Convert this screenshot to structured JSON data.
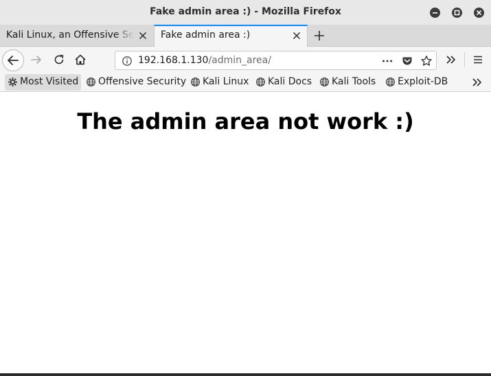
{
  "window": {
    "title": "Fake admin area :) - Mozilla Firefox"
  },
  "tabs": [
    {
      "label": "Kali Linux, an Offensive Security",
      "active": false
    },
    {
      "label": "Fake admin area :)",
      "active": true
    }
  ],
  "urlbar": {
    "host": "192.168.1.130",
    "path": "/admin_area/"
  },
  "bookmarks": [
    {
      "label": "Most Visited",
      "icon": "gear-icon"
    },
    {
      "label": "Offensive Security",
      "icon": "globe-icon"
    },
    {
      "label": "Kali Linux",
      "icon": "globe-icon"
    },
    {
      "label": "Kali Docs",
      "icon": "globe-icon"
    },
    {
      "label": "Kali Tools",
      "icon": "globe-icon"
    },
    {
      "label": "Exploit-DB",
      "icon": "globe-icon"
    }
  ],
  "page": {
    "heading": "The admin area not work :)"
  },
  "colors": {
    "accent": "#0a84ff",
    "wm_button": "#3c3c3c"
  }
}
